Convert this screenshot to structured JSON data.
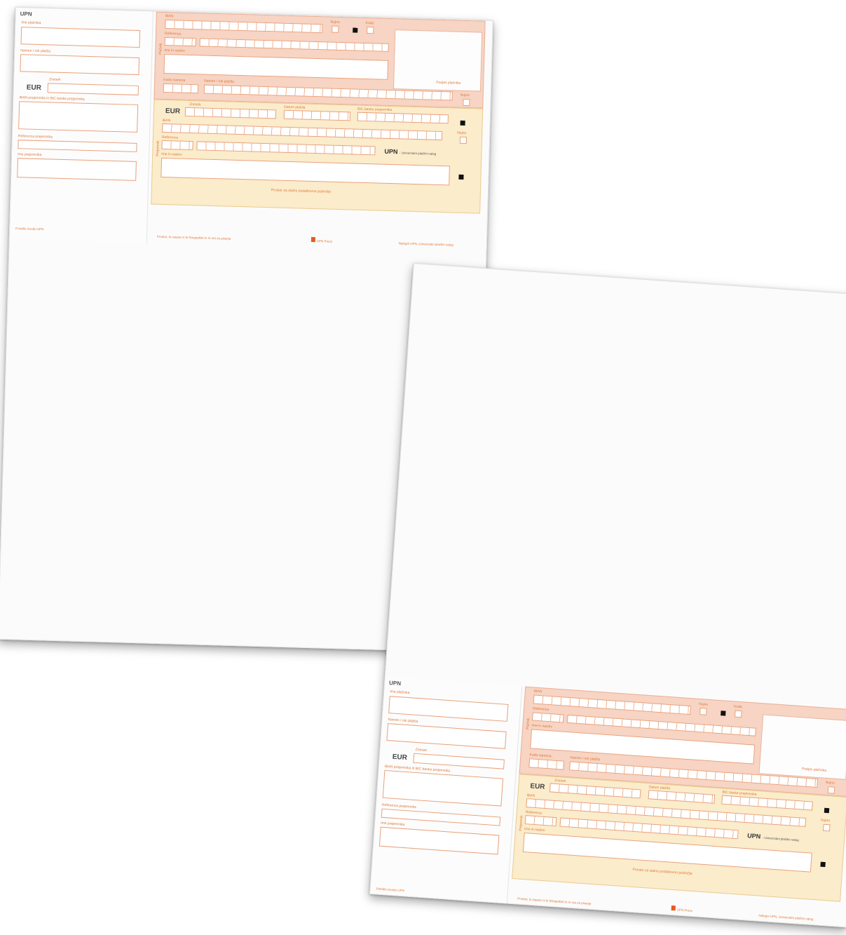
{
  "upn": "UPN",
  "eur": "EUR",
  "stub": {
    "payer_name": "Ime plačnika",
    "purpose": "Namen / rok plačila",
    "amount": "Znesek",
    "iban_bic": "IBAN prejemnika in BIC banke prejemnika",
    "reference": "Referenca prejemnika",
    "recipient_name": "Ime prejemnika",
    "footer": "Potrdilo izvodu UPN"
  },
  "top": {
    "iban": "IBAN",
    "urgent": "Nujno",
    "code": "Koda",
    "reference": "Referenca",
    "name_address": "Ime in naslov",
    "purpose_code": "Koda namena",
    "purpose": "Namen / rok plačila",
    "stamp_label": "Podpis plačnika",
    "side_label": "Plačnik",
    "retrieve": "Nujno"
  },
  "bottom": {
    "amount": "Znesek",
    "date": "Datum plačila",
    "bic": "BIC banke prejemnika",
    "iban": "IBAN",
    "reference": "Referenca",
    "name_address": "Ime in naslov",
    "side_label": "Prejemnik",
    "upn_subtitle": "- Univerzalni plačilni nalog",
    "notice": "Prostor za stalno podatkovno področje",
    "retrieve": "Nujno"
  },
  "footer": {
    "left": "Prostor, ki ostane ni le fiziografski in ni ura za pisanje",
    "right": "Nalogni UPN, Univerzalni plačilni nalog",
    "brand": "UPN Press"
  }
}
